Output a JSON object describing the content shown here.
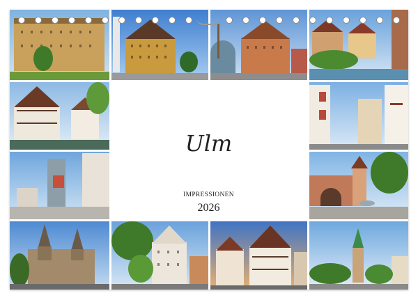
{
  "calendar": {
    "title": "Ulm",
    "subtitle": "IMPRESSIONEN",
    "year": "2026"
  },
  "colors": {
    "page_background": "#ffffff",
    "title_text": "#222222"
  }
}
